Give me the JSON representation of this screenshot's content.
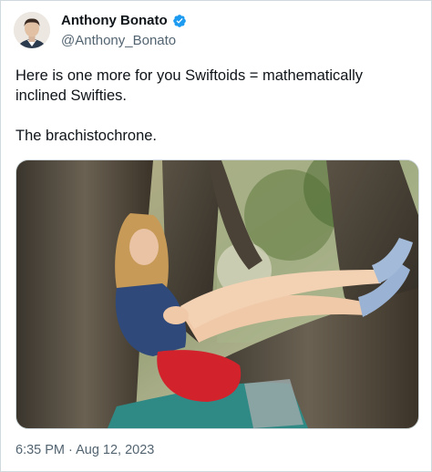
{
  "author": {
    "display_name": "Anthony Bonato",
    "handle": "@Anthony_Bonato",
    "verified": true,
    "avatar_icon": "profile-photo"
  },
  "tweet": {
    "paragraphs": [
      "Here is one more for you Swiftoids = mathematically inclined Swifties.",
      "The brachistochrone."
    ],
    "media": {
      "description_icon": "photo",
      "alt": ""
    },
    "timestamp": "6:35 PM · Aug 12, 2023"
  },
  "colors": {
    "verified_blue": "#1d9bf0",
    "text_primary": "#0f1419",
    "text_secondary": "#536471",
    "border": "#cfd9de"
  }
}
